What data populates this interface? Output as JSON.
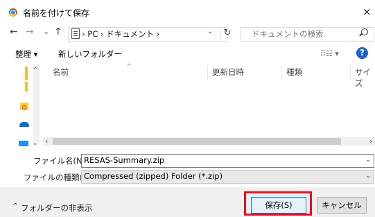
{
  "window": {
    "title": "名前を付けて保存",
    "close_glyph": "×"
  },
  "nav": {
    "back": "←",
    "forward": "→",
    "recent": "⌄",
    "up": "↑",
    "breadcrumb": "›  PC  ›  ドキュメント  ›",
    "refresh": "↻",
    "search_placeholder": "ドキュメントの検索"
  },
  "toolbar": {
    "organize": "整理 ▾",
    "new_folder": "新しいフォルダー",
    "view": "⠿☷ ▾",
    "help": "?"
  },
  "columns": {
    "name": "名前",
    "modified": "更新日時",
    "type": "種類",
    "size": "サイズ",
    "sort_indicator": "^"
  },
  "form": {
    "filename_label": "ファイル名(N):",
    "filename_value": "RESAS-Summary.zip",
    "filetype_label": "ファイルの種類(T):",
    "filetype_value": "Compressed (zipped) Folder (*.zip)"
  },
  "footer": {
    "hide_folders": "フォルダーの非表示",
    "save": "保存(S)",
    "cancel": "キャンセル"
  },
  "colors": {
    "highlight": "#e8101c",
    "accent": "#0078d7"
  }
}
